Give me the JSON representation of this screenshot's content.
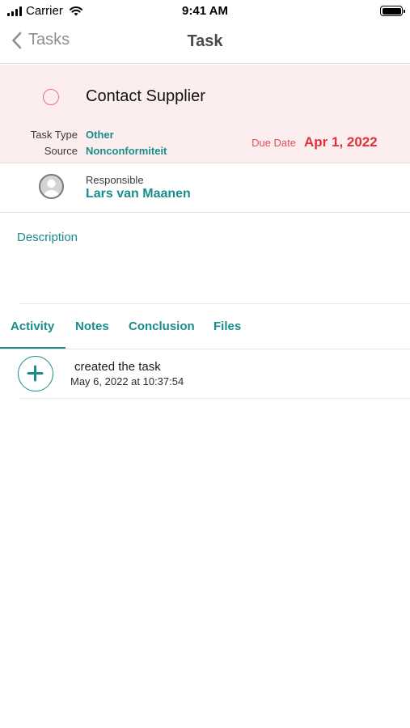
{
  "status_bar": {
    "carrier": "Carrier",
    "time": "9:41 AM",
    "icons": [
      "signal-icon",
      "wifi-icon",
      "battery-icon"
    ]
  },
  "nav": {
    "back_label": "Tasks",
    "title": "Task"
  },
  "task": {
    "title": "Contact Supplier",
    "task_type_label": "Task Type",
    "task_type_value": "Other",
    "source_label": "Source",
    "source_value": "Nonconformiteit",
    "due_label": "Due Date",
    "due_value": "Apr 1, 2022"
  },
  "responsible": {
    "label": "Responsible",
    "name": "Lars van Maanen"
  },
  "description": {
    "label": "Description"
  },
  "tabs": [
    {
      "label": "Activity",
      "active": true
    },
    {
      "label": "Notes",
      "active": false
    },
    {
      "label": "Conclusion",
      "active": false
    },
    {
      "label": "Files",
      "active": false
    }
  ],
  "activity": [
    {
      "text": "created the task",
      "timestamp": "May 6, 2022 at 10:37:54",
      "icon": "plus-icon"
    }
  ],
  "colors": {
    "accent": "#1a8c8c",
    "header_bg": "#fceeee",
    "due": "#e0303c",
    "checkbox": "#e5737a"
  }
}
